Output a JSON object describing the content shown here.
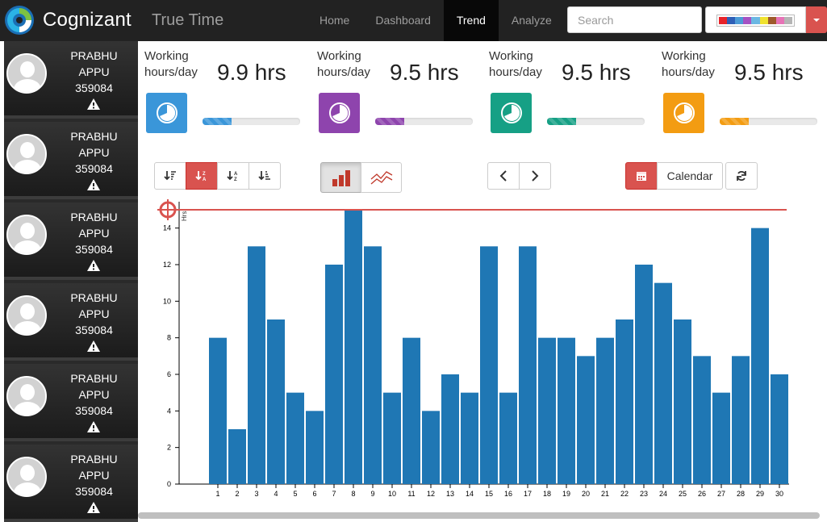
{
  "navbar": {
    "brand": "Cognizant",
    "app_title": "True Time",
    "items": [
      {
        "label": "Home",
        "active": false
      },
      {
        "label": "Dashboard",
        "active": false
      },
      {
        "label": "Trend",
        "active": true
      },
      {
        "label": "Analyze",
        "active": false
      }
    ],
    "search_placeholder": "Search",
    "theme_swatches": [
      "#e8232a",
      "#2e5fb7",
      "#4c9bd6",
      "#a552c3",
      "#6bb7e3",
      "#f0e22f",
      "#9e5a2b",
      "#e773b7",
      "#b5b5b5"
    ],
    "accent": "#d9534f"
  },
  "employees": [
    {
      "first": "PRABHU",
      "last": "APPU",
      "id": "359084"
    },
    {
      "first": "PRABHU",
      "last": "APPU",
      "id": "359084"
    },
    {
      "first": "PRABHU",
      "last": "APPU",
      "id": "359084"
    },
    {
      "first": "PRABHU",
      "last": "APPU",
      "id": "359084"
    },
    {
      "first": "PRABHU",
      "last": "APPU",
      "id": "359084"
    },
    {
      "first": "PRABHU",
      "last": "APPU",
      "id": "359084"
    }
  ],
  "stats": [
    {
      "label": "Working hours/day",
      "value": "9.9 hrs",
      "color": "#3a96d9",
      "bar_color": "#3a96d9",
      "progress": 0.3
    },
    {
      "label": "Working hours/day",
      "value": "9.5 hrs",
      "color": "#8e44ad",
      "bar_color": "#8e44ad",
      "progress": 0.3
    },
    {
      "label": "Working hours/day",
      "value": "9.5 hrs",
      "color": "#16a085",
      "bar_color": "#16a085",
      "progress": 0.3
    },
    {
      "label": "Working hours/day",
      "value": "9.5 hrs",
      "color": "#f39c12",
      "bar_color": "#f39c12",
      "progress": 0.3
    }
  ],
  "toolbar": {
    "calendar_label": "Calendar"
  },
  "chart_data": {
    "type": "bar",
    "ylabel": "Hrs",
    "ylim": [
      0,
      15
    ],
    "yticks": [
      0,
      2,
      4,
      6,
      8,
      10,
      12,
      14
    ],
    "threshold": 15,
    "bar_color": "#1f77b4",
    "threshold_color": "#d9534f",
    "categories": [
      "1",
      "2",
      "3",
      "4",
      "5",
      "6",
      "7",
      "8",
      "9",
      "10",
      "11",
      "12",
      "13",
      "14",
      "15",
      "16",
      "17",
      "18",
      "19",
      "20",
      "21",
      "22",
      "23",
      "24",
      "25",
      "26",
      "27",
      "28",
      "29",
      "30"
    ],
    "values": [
      8,
      3,
      13,
      9,
      5,
      4,
      12,
      15,
      13,
      5,
      8,
      4,
      6,
      5,
      13,
      5,
      13,
      8,
      8,
      7,
      8,
      9,
      12,
      11,
      9,
      7,
      5,
      7,
      14,
      6
    ]
  }
}
